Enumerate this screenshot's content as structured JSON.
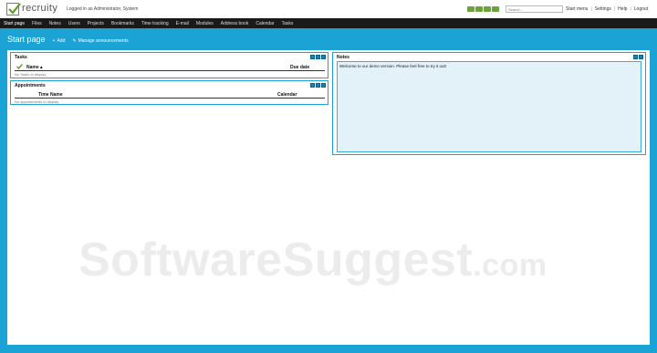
{
  "app": {
    "logo_text": "recruity",
    "login_info": "Logged in as Administrator, System"
  },
  "search": {
    "placeholder": "Search..."
  },
  "top_links": [
    "Start menu",
    "Settings",
    "Help",
    "Logout"
  ],
  "nav": [
    "Start page",
    "Files",
    "Notes",
    "Users",
    "Projects",
    "Bookmarks",
    "Time tracking",
    "E-mail",
    "Modules",
    "Address book",
    "Calendar",
    "Tasks"
  ],
  "page": {
    "title": "Start page",
    "add_label": "Add",
    "manage_label": "Manage announcements"
  },
  "tasks": {
    "title": "Tasks",
    "col_name": "Name",
    "col_due": "Due date",
    "empty": "No Tasks to display"
  },
  "appointments": {
    "title": "Appointments",
    "col_time": "Time",
    "col_name": "Name",
    "col_calendar": "Calendar",
    "empty": "No appointments to display"
  },
  "notes": {
    "title": "Notes",
    "text": "Welcome to our demo version. Please feel free to try it out!"
  },
  "watermark": {
    "main": "SoftwareSuggest",
    "suffix": ".com"
  },
  "colors": {
    "accent": "#1aa3d4",
    "nav_bg": "#1a1a1a",
    "button": "#1d7fb3"
  }
}
